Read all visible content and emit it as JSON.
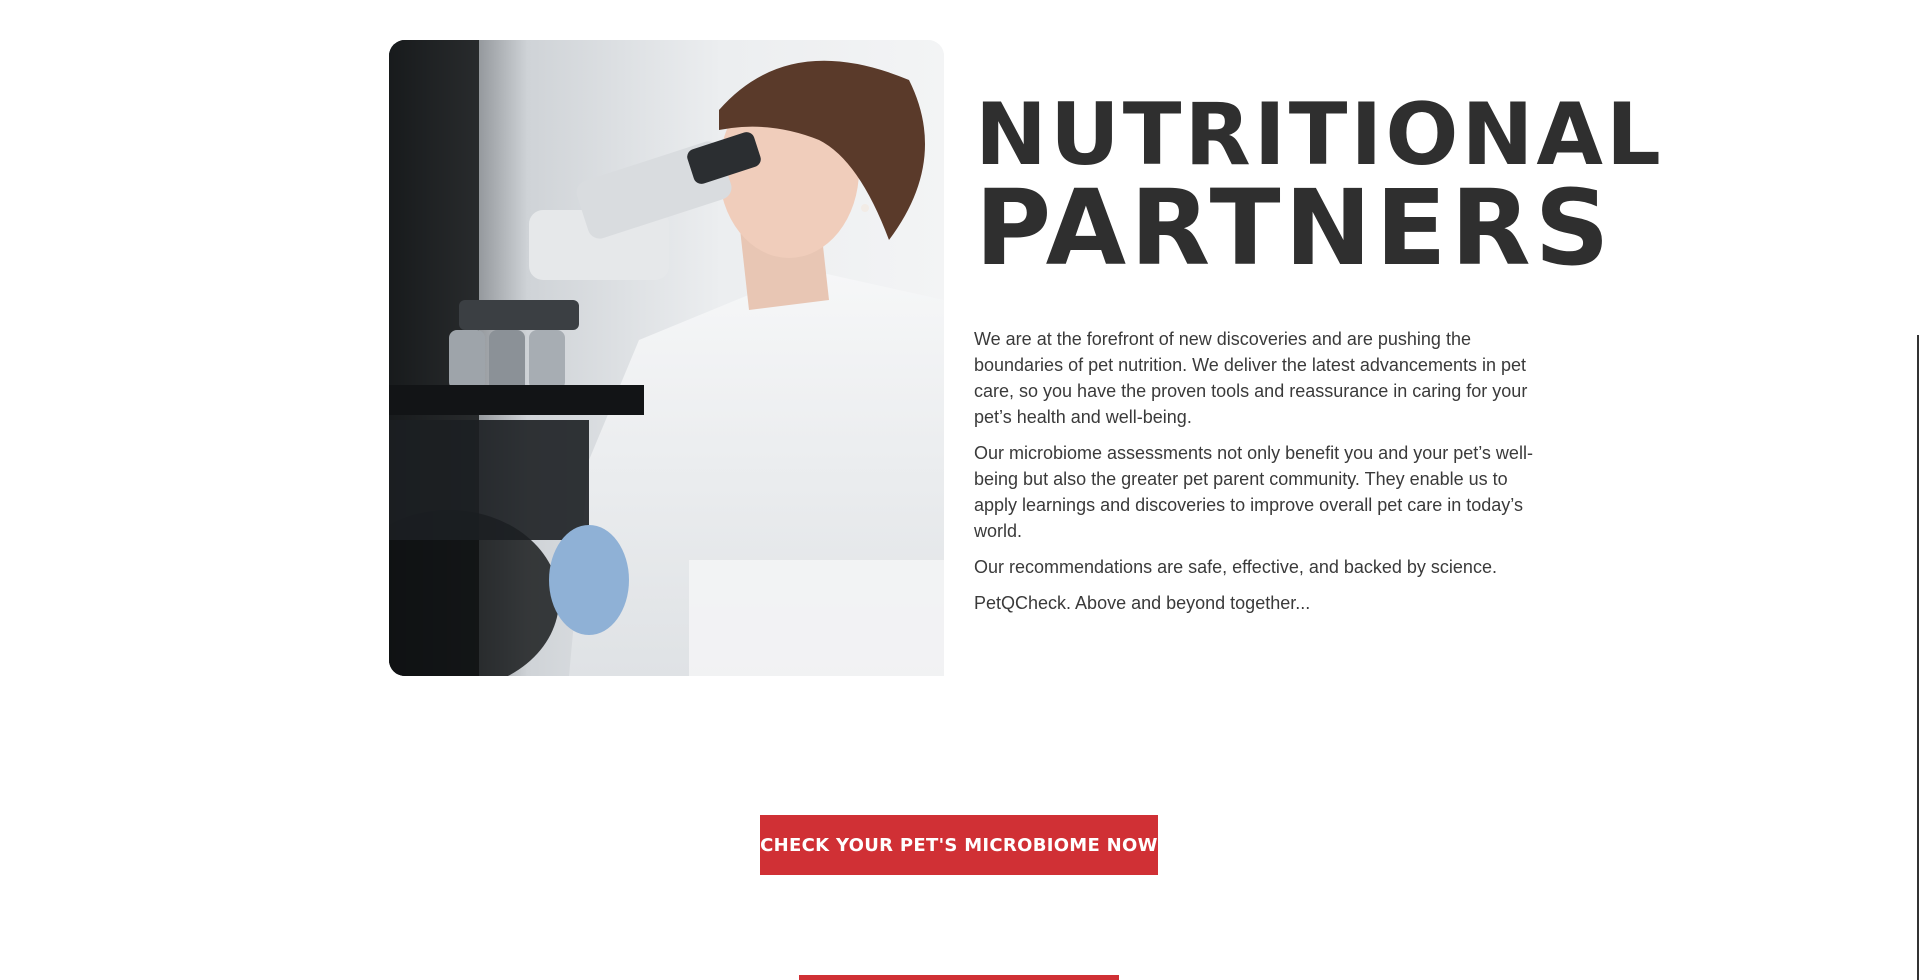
{
  "section": {
    "heading_line1": "NUTRITIONAL",
    "heading_line2": "PARTNERS",
    "paragraphs": [
      "We are at the forefront of new discoveries and are pushing the boundaries of pet nutrition. We deliver the latest advancements in pet care, so you have the proven tools and reassurance in caring for your pet’s health and well-being.",
      "Our microbiome assessments not only benefit you and your pet’s well-being but also the greater pet parent community. They enable us to apply learnings and discoveries to improve overall pet care in today’s world.",
      "Our recommendations are safe, effective, and backed by science.",
      "PetQCheck. Above and beyond together..."
    ]
  },
  "cta": {
    "label": "CHECK YOUR PET'S MICROBIOME NOW",
    "color": "#d03035"
  },
  "colors": {
    "heading": "#2f2f2f",
    "body_text": "#3a3a3a",
    "background": "#ffffff"
  },
  "image": {
    "subject": "scientist-with-microscope"
  }
}
